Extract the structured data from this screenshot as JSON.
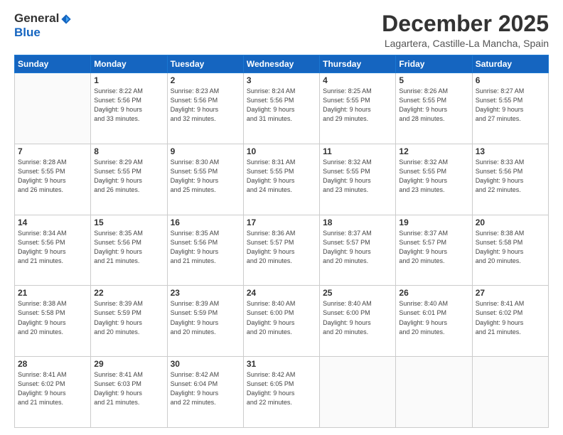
{
  "logo": {
    "general": "General",
    "blue": "Blue"
  },
  "header": {
    "month": "December 2025",
    "location": "Lagartera, Castille-La Mancha, Spain"
  },
  "weekdays": [
    "Sunday",
    "Monday",
    "Tuesday",
    "Wednesday",
    "Thursday",
    "Friday",
    "Saturday"
  ],
  "weeks": [
    [
      {
        "day": "",
        "info": ""
      },
      {
        "day": "1",
        "info": "Sunrise: 8:22 AM\nSunset: 5:56 PM\nDaylight: 9 hours\nand 33 minutes."
      },
      {
        "day": "2",
        "info": "Sunrise: 8:23 AM\nSunset: 5:56 PM\nDaylight: 9 hours\nand 32 minutes."
      },
      {
        "day": "3",
        "info": "Sunrise: 8:24 AM\nSunset: 5:56 PM\nDaylight: 9 hours\nand 31 minutes."
      },
      {
        "day": "4",
        "info": "Sunrise: 8:25 AM\nSunset: 5:55 PM\nDaylight: 9 hours\nand 29 minutes."
      },
      {
        "day": "5",
        "info": "Sunrise: 8:26 AM\nSunset: 5:55 PM\nDaylight: 9 hours\nand 28 minutes."
      },
      {
        "day": "6",
        "info": "Sunrise: 8:27 AM\nSunset: 5:55 PM\nDaylight: 9 hours\nand 27 minutes."
      }
    ],
    [
      {
        "day": "7",
        "info": "Sunrise: 8:28 AM\nSunset: 5:55 PM\nDaylight: 9 hours\nand 26 minutes."
      },
      {
        "day": "8",
        "info": "Sunrise: 8:29 AM\nSunset: 5:55 PM\nDaylight: 9 hours\nand 26 minutes."
      },
      {
        "day": "9",
        "info": "Sunrise: 8:30 AM\nSunset: 5:55 PM\nDaylight: 9 hours\nand 25 minutes."
      },
      {
        "day": "10",
        "info": "Sunrise: 8:31 AM\nSunset: 5:55 PM\nDaylight: 9 hours\nand 24 minutes."
      },
      {
        "day": "11",
        "info": "Sunrise: 8:32 AM\nSunset: 5:55 PM\nDaylight: 9 hours\nand 23 minutes."
      },
      {
        "day": "12",
        "info": "Sunrise: 8:32 AM\nSunset: 5:55 PM\nDaylight: 9 hours\nand 23 minutes."
      },
      {
        "day": "13",
        "info": "Sunrise: 8:33 AM\nSunset: 5:56 PM\nDaylight: 9 hours\nand 22 minutes."
      }
    ],
    [
      {
        "day": "14",
        "info": "Sunrise: 8:34 AM\nSunset: 5:56 PM\nDaylight: 9 hours\nand 21 minutes."
      },
      {
        "day": "15",
        "info": "Sunrise: 8:35 AM\nSunset: 5:56 PM\nDaylight: 9 hours\nand 21 minutes."
      },
      {
        "day": "16",
        "info": "Sunrise: 8:35 AM\nSunset: 5:56 PM\nDaylight: 9 hours\nand 21 minutes."
      },
      {
        "day": "17",
        "info": "Sunrise: 8:36 AM\nSunset: 5:57 PM\nDaylight: 9 hours\nand 20 minutes."
      },
      {
        "day": "18",
        "info": "Sunrise: 8:37 AM\nSunset: 5:57 PM\nDaylight: 9 hours\nand 20 minutes."
      },
      {
        "day": "19",
        "info": "Sunrise: 8:37 AM\nSunset: 5:57 PM\nDaylight: 9 hours\nand 20 minutes."
      },
      {
        "day": "20",
        "info": "Sunrise: 8:38 AM\nSunset: 5:58 PM\nDaylight: 9 hours\nand 20 minutes."
      }
    ],
    [
      {
        "day": "21",
        "info": "Sunrise: 8:38 AM\nSunset: 5:58 PM\nDaylight: 9 hours\nand 20 minutes."
      },
      {
        "day": "22",
        "info": "Sunrise: 8:39 AM\nSunset: 5:59 PM\nDaylight: 9 hours\nand 20 minutes."
      },
      {
        "day": "23",
        "info": "Sunrise: 8:39 AM\nSunset: 5:59 PM\nDaylight: 9 hours\nand 20 minutes."
      },
      {
        "day": "24",
        "info": "Sunrise: 8:40 AM\nSunset: 6:00 PM\nDaylight: 9 hours\nand 20 minutes."
      },
      {
        "day": "25",
        "info": "Sunrise: 8:40 AM\nSunset: 6:00 PM\nDaylight: 9 hours\nand 20 minutes."
      },
      {
        "day": "26",
        "info": "Sunrise: 8:40 AM\nSunset: 6:01 PM\nDaylight: 9 hours\nand 20 minutes."
      },
      {
        "day": "27",
        "info": "Sunrise: 8:41 AM\nSunset: 6:02 PM\nDaylight: 9 hours\nand 21 minutes."
      }
    ],
    [
      {
        "day": "28",
        "info": "Sunrise: 8:41 AM\nSunset: 6:02 PM\nDaylight: 9 hours\nand 21 minutes."
      },
      {
        "day": "29",
        "info": "Sunrise: 8:41 AM\nSunset: 6:03 PM\nDaylight: 9 hours\nand 21 minutes."
      },
      {
        "day": "30",
        "info": "Sunrise: 8:42 AM\nSunset: 6:04 PM\nDaylight: 9 hours\nand 22 minutes."
      },
      {
        "day": "31",
        "info": "Sunrise: 8:42 AM\nSunset: 6:05 PM\nDaylight: 9 hours\nand 22 minutes."
      },
      {
        "day": "",
        "info": ""
      },
      {
        "day": "",
        "info": ""
      },
      {
        "day": "",
        "info": ""
      }
    ]
  ]
}
